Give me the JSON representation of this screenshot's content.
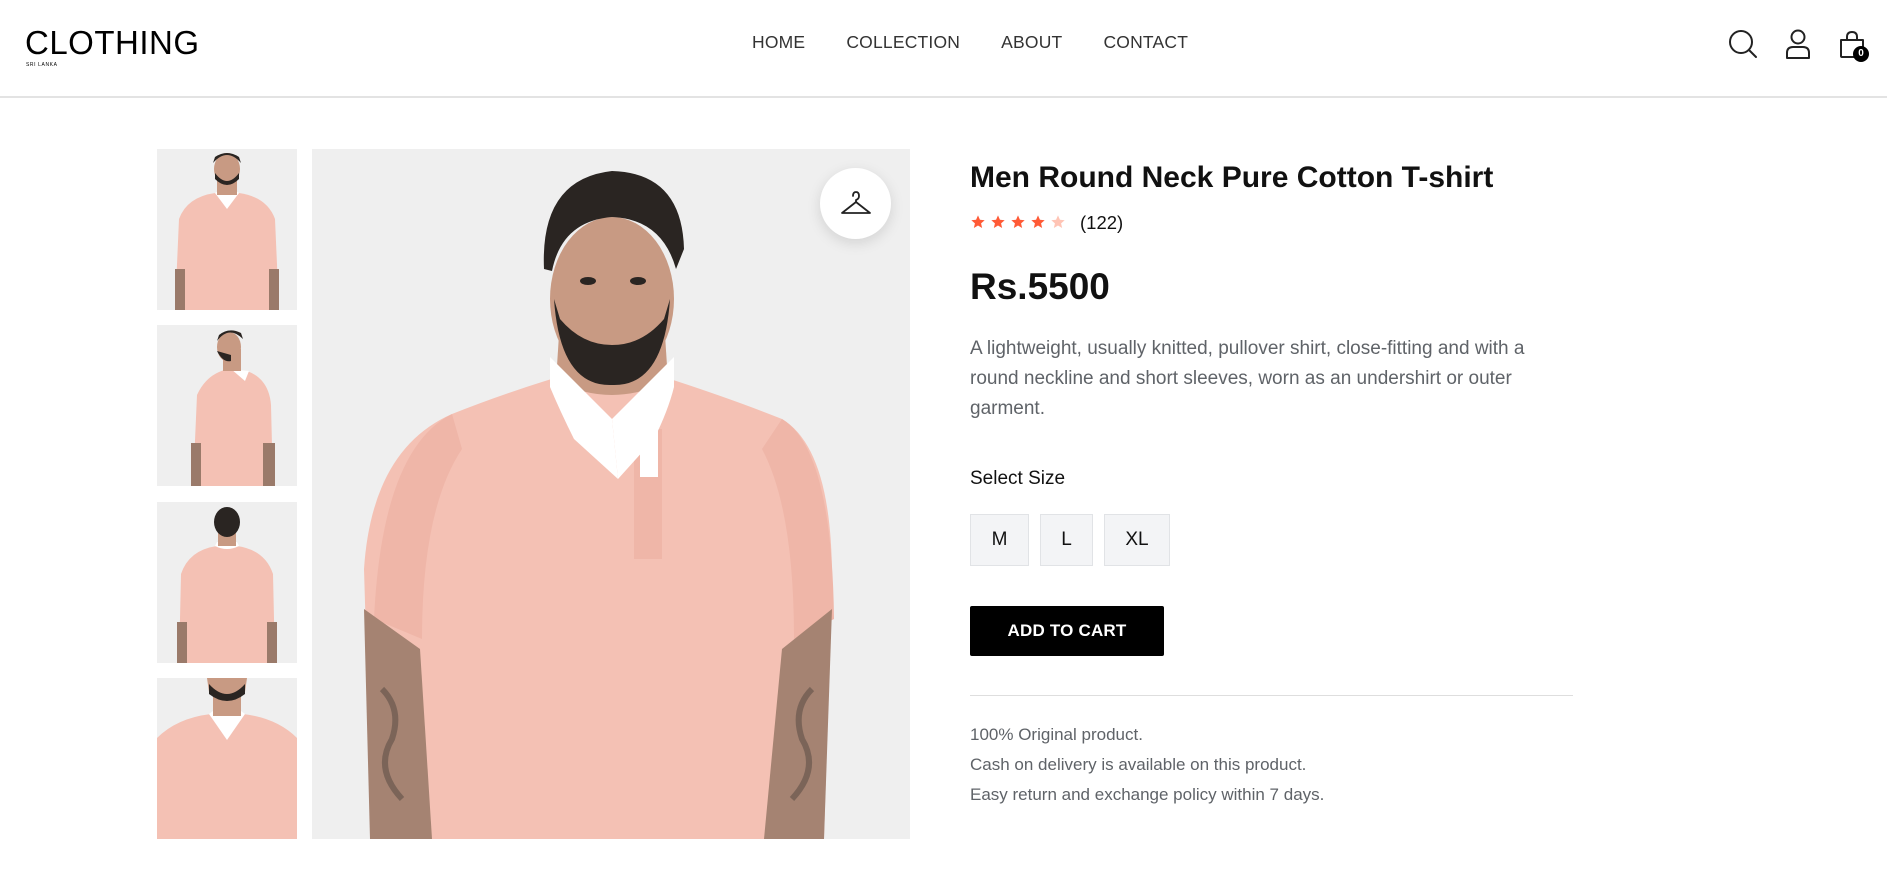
{
  "header": {
    "logo_text": "CLOTHING",
    "logo_sub": "SRI LANKA",
    "nav": [
      {
        "label": "HOME"
      },
      {
        "label": "COLLECTION"
      },
      {
        "label": "ABOUT"
      },
      {
        "label": "CONTACT"
      }
    ],
    "cart_count": "0",
    "icons": [
      "search-icon",
      "user-icon",
      "shopping-bag-icon"
    ]
  },
  "gallery": {
    "thumbnails": [
      "front view",
      "side view",
      "back view",
      "close-up view"
    ],
    "main_image": "model wearing pink polo t-shirt",
    "try_on_icon": "hanger-icon"
  },
  "product": {
    "title": "Men Round Neck Pure Cotton T-shirt",
    "rating": 4,
    "rating_max": 5,
    "review_count": "(122)",
    "price": "Rs.5500",
    "description": "A lightweight, usually knitted, pullover shirt, close-fitting and with a round neckline and short sleeves, worn as an undershirt or outer garment.",
    "size_label": "Select Size",
    "sizes": [
      "M",
      "L",
      "XL"
    ],
    "add_to_cart_label": "ADD TO CART",
    "policies": [
      "100% Original product.",
      "Cash on delivery is available on this product.",
      "Easy return and exchange policy within 7 days."
    ]
  },
  "colors": {
    "star_filled": "#ff5a36",
    "star_empty": "#ffc4b5",
    "shirt": "#f4c1b4",
    "image_bg": "#efefef"
  }
}
